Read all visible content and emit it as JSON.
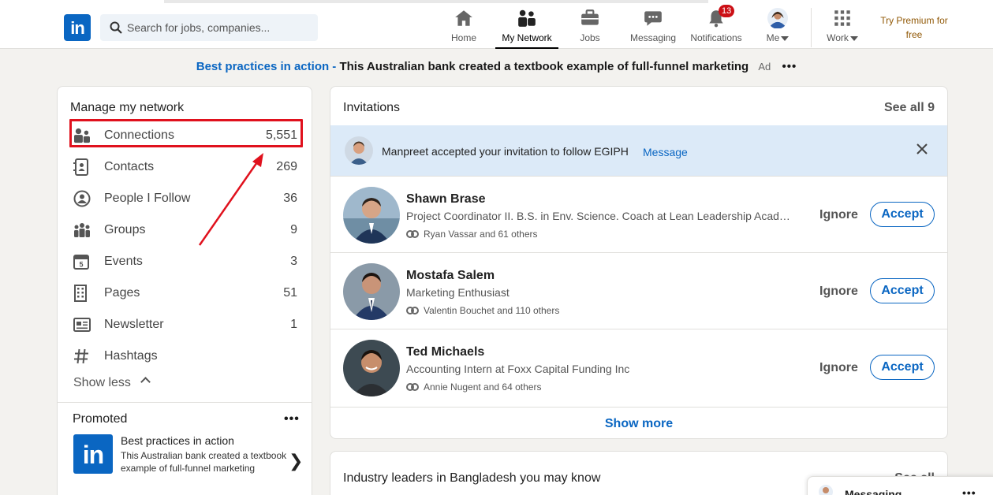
{
  "search": {
    "placeholder": "Search for jobs, companies..."
  },
  "nav": {
    "home": "Home",
    "network": "My Network",
    "jobs": "Jobs",
    "messaging": "Messaging",
    "notifications": "Notifications",
    "notifications_count": "13",
    "me": "Me",
    "work": "Work",
    "premium": "Try Premium for free"
  },
  "ad": {
    "link": "Best practices in action -",
    "text": "This Australian bank created a textbook example of full-funnel marketing",
    "tag": "Ad",
    "more": "•••"
  },
  "network": {
    "title": "Manage my network",
    "items": [
      {
        "label": "Connections",
        "count": "5,551",
        "icon": "connections-icon"
      },
      {
        "label": "Contacts",
        "count": "269",
        "icon": "contacts-icon"
      },
      {
        "label": "People I Follow",
        "count": "36",
        "icon": "people-follow-icon"
      },
      {
        "label": "Groups",
        "count": "9",
        "icon": "groups-icon"
      },
      {
        "label": "Events",
        "count": "3",
        "icon": "events-icon"
      },
      {
        "label": "Pages",
        "count": "51",
        "icon": "pages-icon"
      },
      {
        "label": "Newsletter",
        "count": "1",
        "icon": "newsletter-icon"
      },
      {
        "label": "Hashtags",
        "count": "",
        "icon": "hashtag-icon"
      }
    ],
    "show_less": "Show less",
    "event_day": "5"
  },
  "promoted": {
    "title": "Promoted",
    "more": "•••",
    "ad_title": "Best practices in action",
    "ad_desc": "This Australian bank created a textbook example of full-funnel marketing",
    "chevron": "❯"
  },
  "invitations": {
    "title": "Invitations",
    "see_all": "See all 9",
    "notice": {
      "text": "Manpreet accepted your invitation to follow EGIPH",
      "action": "Message"
    },
    "people": [
      {
        "name": "Shawn Brase",
        "headline": "Project Coordinator II. B.S. in Env. Science. Coach at Lean Leadership Academy. Ex-Corporate Recruiter",
        "mutual": "Ryan Vassar and 61 others",
        "ignore": "Ignore",
        "accept": "Accept"
      },
      {
        "name": "Mostafa Salem",
        "headline": "Marketing Enthusiast",
        "mutual": "Valentin Bouchet and 110 others",
        "ignore": "Ignore",
        "accept": "Accept"
      },
      {
        "name": "Ted Michaels",
        "headline": "Accounting Intern at Foxx Capital Funding Inc",
        "mutual": "Annie Nugent and 64 others",
        "ignore": "Ignore",
        "accept": "Accept"
      }
    ],
    "show_more": "Show more"
  },
  "industry": {
    "title": "Industry leaders in Bangladesh you may know",
    "see_all": "See all"
  },
  "messaging_bar": {
    "title": "Messaging",
    "more": "•••"
  },
  "colors": {
    "brand": "#0a66c2",
    "highlight": "#e0111d",
    "badge": "#cc1016",
    "notice_bg": "#dceaf8"
  }
}
